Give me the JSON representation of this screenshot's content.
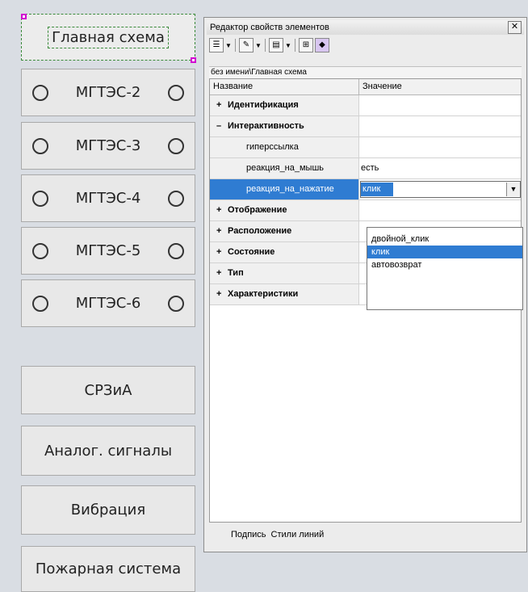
{
  "nav": {
    "main": "Главная схема",
    "stations": [
      "МГТЭС-2",
      "МГТЭС-3",
      "МГТЭС-4",
      "МГТЭС-5",
      "МГТЭС-6"
    ],
    "lower": [
      "СРЗиА",
      "Аналог. сигналы",
      "Вибрация",
      "Пожарная система"
    ]
  },
  "editor": {
    "title": "Редактор свойств элементов",
    "close": "✕",
    "path": "без имени\\Главная схема",
    "col_name": "Название",
    "col_value": "Значение",
    "rows": {
      "identification": "Идентификация",
      "interactivity": "Интерактивность",
      "hyperlink": "гиперссылка",
      "mouse_reaction": "реакция_на_мышь",
      "mouse_reaction_value": "есть",
      "click_reaction": "реакция_на_нажатие",
      "click_reaction_value": "клик",
      "display": "Отображение",
      "layout": "Расположение",
      "state": "Состояние",
      "type": "Тип",
      "characteristics": "Характеристики"
    },
    "dropdown_options": [
      "двойной_клик",
      "клик",
      "автовозврат"
    ],
    "tabs": [
      "Подпись",
      "Стили линий"
    ]
  },
  "colors": {
    "selection": "#2f7cd2",
    "handle": "#d100d1"
  }
}
